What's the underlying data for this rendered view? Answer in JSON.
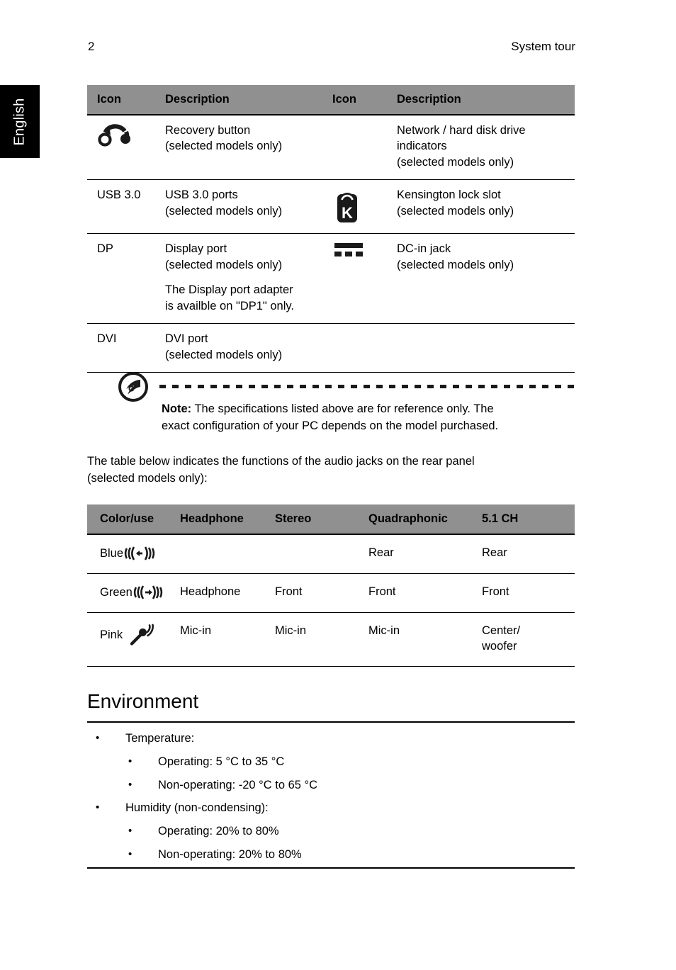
{
  "header": {
    "page_number": "2",
    "section_title": "System tour"
  },
  "language_tab": {
    "label": "English"
  },
  "ports_table": {
    "headers": [
      "Icon",
      "Description",
      "Icon",
      "Description"
    ],
    "rows": [
      {
        "icon1_type": "recovery-button-icon",
        "icon1_text": "",
        "desc1_line1": "Recovery button",
        "desc1_line2": "(selected models only)",
        "desc1_line3": "",
        "desc1_line4": "",
        "icon2_type": "none",
        "icon2_text": "",
        "desc2_line1": "Network / hard disk drive",
        "desc2_line2": "indicators",
        "desc2_line3": "(selected models only)"
      },
      {
        "icon1_type": "text",
        "icon1_text": "USB 3.0",
        "desc1_line1": "USB 3.0 ports",
        "desc1_line2": "(selected models only)",
        "desc1_line3": "",
        "desc1_line4": "",
        "icon2_type": "kensington-lock-icon",
        "icon2_text": "",
        "desc2_line1": "Kensington lock slot",
        "desc2_line2": "(selected models only)",
        "desc2_line3": ""
      },
      {
        "icon1_type": "text",
        "icon1_text": "DP",
        "desc1_line1": "Display port",
        "desc1_line2": "(selected models only)",
        "desc1_line3": "The Display port adapter",
        "desc1_line4": "is availble on \"DP1\" only.",
        "icon2_type": "dc-in-jack-icon",
        "icon2_text": "",
        "desc2_line1": "DC-in jack",
        "desc2_line2": "(selected models only)",
        "desc2_line3": ""
      },
      {
        "icon1_type": "text",
        "icon1_text": "DVI",
        "desc1_line1": "DVI port",
        "desc1_line2": "(selected models only)",
        "desc1_line3": "",
        "desc1_line4": "",
        "icon2_type": "none",
        "icon2_text": "",
        "desc2_line1": "",
        "desc2_line2": "",
        "desc2_line3": ""
      }
    ]
  },
  "note": {
    "icon": "acer-note-icon",
    "label": "Note:",
    "line1": " The specifications listed above are for reference only. The",
    "line2": "exact configuration of your PC depends on the model purchased."
  },
  "intro_paragraph": {
    "line1": "The table below indicates the functions of the audio jacks on the rear panel",
    "line2": "(selected models only):"
  },
  "audio_table": {
    "headers": [
      "Color/use",
      "Headphone",
      "Stereo",
      "Quadraphonic",
      "5.1 CH"
    ],
    "rows": [
      {
        "color": "Blue",
        "icon": "line-in-icon",
        "headphone": "",
        "stereo": "",
        "quadraphonic": "Rear",
        "ch51_line1": "Rear",
        "ch51_line2": ""
      },
      {
        "color": "Green",
        "icon": "line-out-icon",
        "headphone": "Headphone",
        "stereo": "Front",
        "quadraphonic": "Front",
        "ch51_line1": "Front",
        "ch51_line2": ""
      },
      {
        "color": "Pink",
        "icon": "microphone-icon",
        "headphone": "Mic-in",
        "stereo": "Mic-in",
        "quadraphonic": "Mic-in",
        "ch51_line1": "Center/",
        "ch51_line2": "woofer"
      }
    ]
  },
  "environment": {
    "heading": "Environment",
    "bullets": [
      {
        "level": 1,
        "mark": "•",
        "text": "Temperature:"
      },
      {
        "level": 2,
        "mark": "•",
        "text": "Operating: 5 °C to 35 °C"
      },
      {
        "level": 2,
        "mark": "•",
        "text": "Non-operating: -20 °C to 65 °C"
      },
      {
        "level": 1,
        "mark": "•",
        "text": "Humidity (non-condensing):"
      },
      {
        "level": 2,
        "mark": "•",
        "text": "Operating: 20% to 80%"
      },
      {
        "level": 2,
        "mark": "•",
        "text": "Non-operating: 20% to 80%"
      }
    ]
  },
  "colors": {
    "table_header_gray": "#909090",
    "tab_black": "#000000",
    "text": "#000000",
    "page_background": "#ffffff"
  }
}
